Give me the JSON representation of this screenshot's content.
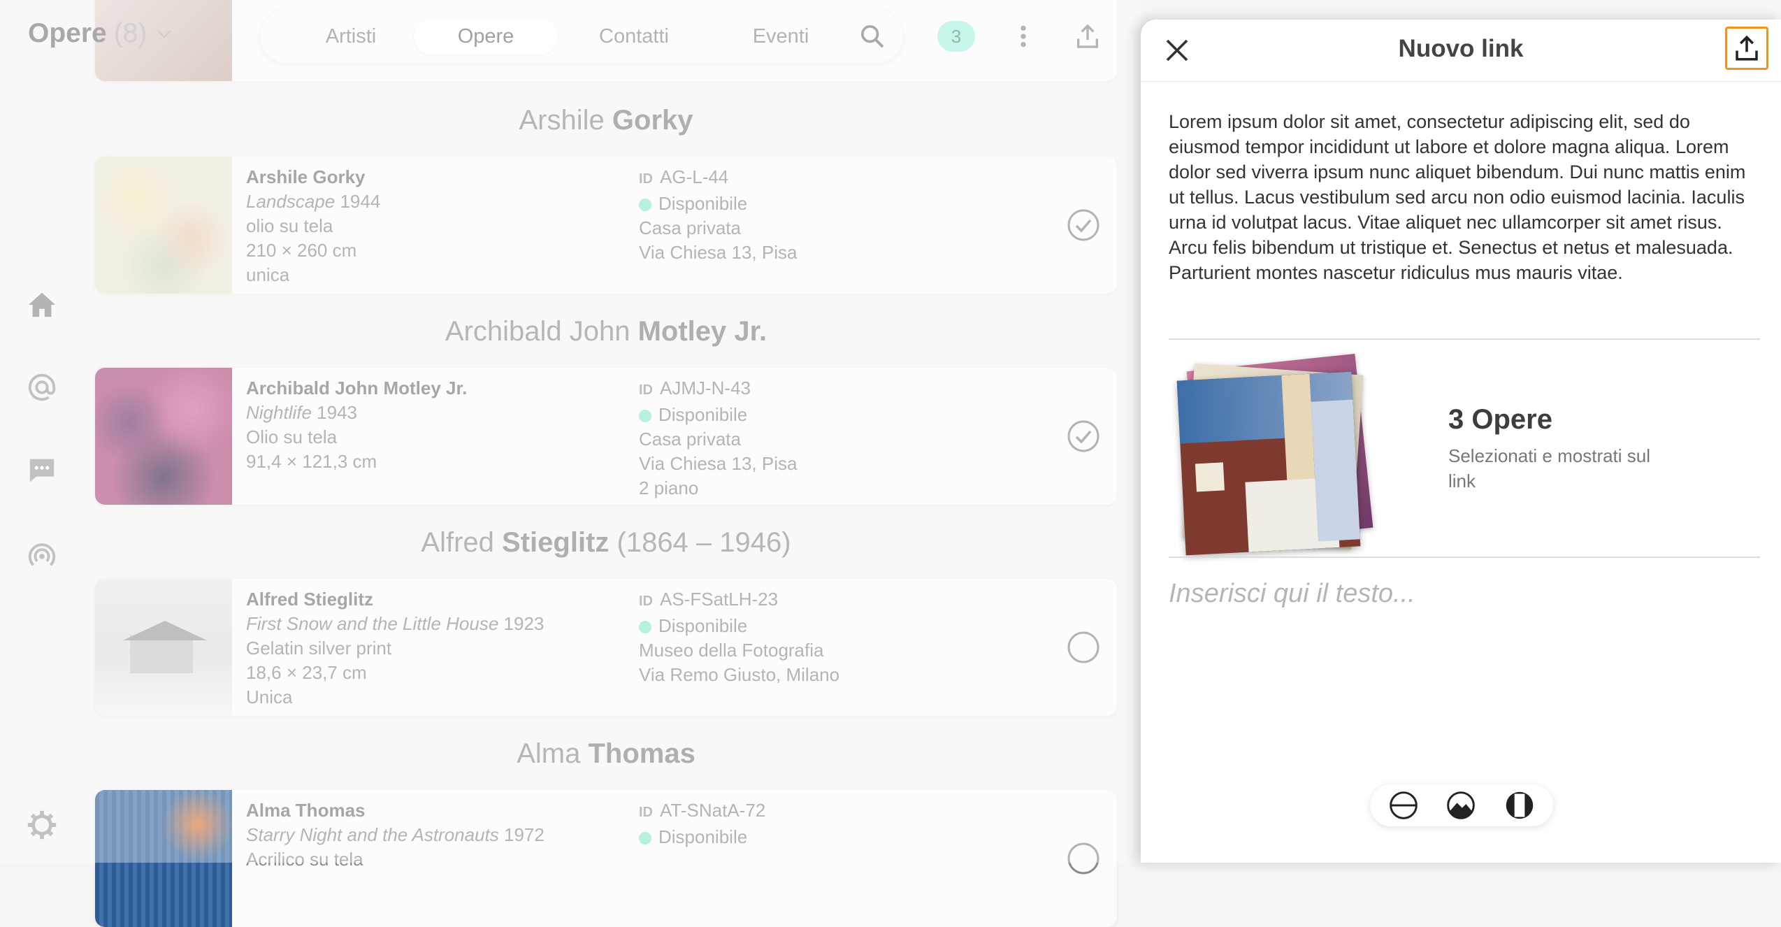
{
  "header": {
    "list_title": "Opere",
    "list_count": "(8)",
    "nav_tabs": [
      "Artisti",
      "Opere",
      "Contatti",
      "Eventi"
    ],
    "active_tab": "Opere",
    "selected_badge": "3"
  },
  "groups": [
    {
      "heading_first": "Arshile",
      "heading_last": "Gorky",
      "heading_extra": "",
      "card": {
        "artist": "Arshile Gorky",
        "title": "Landscape",
        "year": "1944",
        "lines": [
          "olio su tela",
          "210 × 260 cm",
          "unica"
        ],
        "id_label": "ID",
        "id": "AG-L-44",
        "status": "Disponibile",
        "location": [
          "Casa privata",
          "Via Chiesa 13, Pisa"
        ],
        "selected": true
      }
    },
    {
      "heading_first": "Archibald John",
      "heading_last": "Motley Jr.",
      "heading_extra": "",
      "card": {
        "artist": "Archibald John Motley Jr.",
        "title": "Nightlife",
        "year": "1943",
        "lines": [
          "Olio su tela",
          "91,4 × 121,3 cm"
        ],
        "id_label": "ID",
        "id": "AJMJ-N-43",
        "status": "Disponibile",
        "location": [
          "Casa privata",
          "Via Chiesa 13, Pisa",
          "2 piano"
        ],
        "selected": true
      }
    },
    {
      "heading_first": "Alfred",
      "heading_last": "Stieglitz",
      "heading_extra": "(1864 – 1946)",
      "card": {
        "artist": "Alfred Stieglitz",
        "title": "First Snow and the Little House",
        "year": "1923",
        "lines": [
          "Gelatin silver print",
          "18,6 × 23,7 cm",
          "Unica"
        ],
        "id_label": "ID",
        "id": "AS-FSatLH-23",
        "status": "Disponibile",
        "location": [
          "Museo della Fotografia",
          "Via Remo Giusto, Milano"
        ],
        "selected": false
      }
    },
    {
      "heading_first": "Alma",
      "heading_last": "Thomas",
      "heading_extra": "",
      "card": {
        "artist": "Alma Thomas",
        "title": "Starry Night and the Astronauts",
        "year": "1972",
        "lines": [
          "Acrilico su tela"
        ],
        "id_label": "ID",
        "id": "AT-SNatA-72",
        "status": "Disponibile",
        "location": [],
        "selected": false
      }
    }
  ],
  "panel": {
    "title": "Nuovo link",
    "body": "Lorem ipsum dolor sit amet, consectetur adipiscing elit, sed do eiusmod tempor incididunt ut labore et dolore magna aliqua. Lorem dolor sed viverra ipsum nunc aliquet bibendum. Dui nunc mattis enim ut tellus. Lacus vestibulum sed arcu non odio euismod lacinia. Iaculis urna id volutpat lacus. Vitae aliquet nec ullamcorper sit amet risus. Arcu felis bibendum ut tristique et. Senectus et netus et malesuada. Parturient montes nascetur ridiculus mus mauris vitae.",
    "stack_title": "3 Opere",
    "stack_subtitle": "Selezionati e mostrati sul link",
    "compose_placeholder": "Inserisci qui il testo..."
  },
  "icons": {
    "rail": [
      "home-icon",
      "at-icon",
      "chat-icon",
      "broadcast-icon",
      "settings-icon"
    ],
    "top": [
      "search-icon",
      "more-vertical-icon",
      "share-icon"
    ],
    "panel": [
      "close-icon",
      "share-icon"
    ],
    "toolbar": [
      "no-media-icon",
      "image-icon",
      "video-icon"
    ]
  },
  "colors": {
    "accent_badge": "#a8f0e0",
    "status_available": "#8ee8d2",
    "focus_outline": "#f0931f"
  }
}
